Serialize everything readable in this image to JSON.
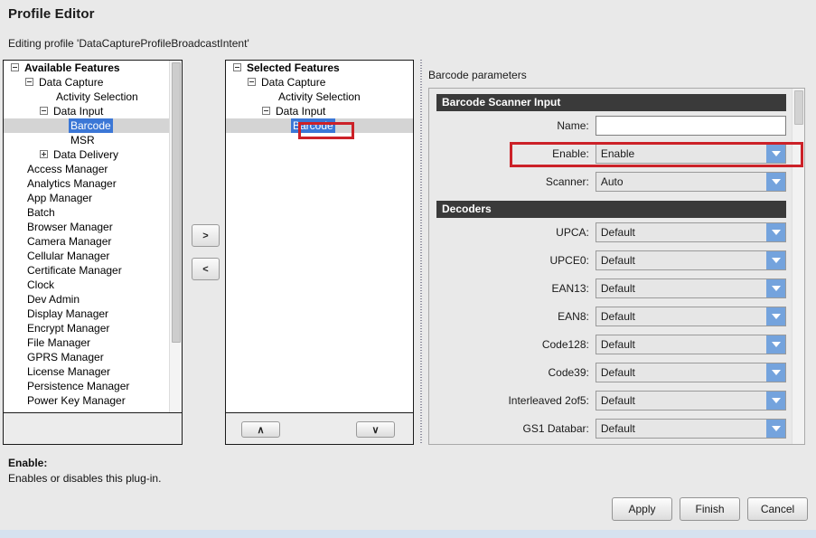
{
  "header": {
    "title": "Profile Editor",
    "subtitle": "Editing profile 'DataCaptureProfileBroadcastIntent'"
  },
  "available_features": {
    "root_label": "Available Features",
    "items": [
      {
        "label": "Available Features",
        "indent": 0,
        "expander": "minus",
        "bold": true,
        "selected": false
      },
      {
        "label": "Data Capture",
        "indent": 1,
        "expander": "minus",
        "bold": false,
        "selected": false
      },
      {
        "label": "Activity Selection",
        "indent": 3,
        "expander": "none",
        "bold": false,
        "selected": false
      },
      {
        "label": "Data Input",
        "indent": 2,
        "expander": "minus",
        "bold": false,
        "selected": false
      },
      {
        "label": "Barcode",
        "indent": 4,
        "expander": "none",
        "bold": false,
        "selected": true
      },
      {
        "label": "MSR",
        "indent": 4,
        "expander": "none",
        "bold": false,
        "selected": false
      },
      {
        "label": "Data Delivery",
        "indent": 2,
        "expander": "plus",
        "bold": false,
        "selected": false
      },
      {
        "label": "Access Manager",
        "indent": 1,
        "expander": "none",
        "bold": false,
        "selected": false
      },
      {
        "label": "Analytics Manager",
        "indent": 1,
        "expander": "none",
        "bold": false,
        "selected": false
      },
      {
        "label": "App Manager",
        "indent": 1,
        "expander": "none",
        "bold": false,
        "selected": false
      },
      {
        "label": "Batch",
        "indent": 1,
        "expander": "none",
        "bold": false,
        "selected": false
      },
      {
        "label": "Browser Manager",
        "indent": 1,
        "expander": "none",
        "bold": false,
        "selected": false
      },
      {
        "label": "Camera Manager",
        "indent": 1,
        "expander": "none",
        "bold": false,
        "selected": false
      },
      {
        "label": "Cellular Manager",
        "indent": 1,
        "expander": "none",
        "bold": false,
        "selected": false
      },
      {
        "label": "Certificate Manager",
        "indent": 1,
        "expander": "none",
        "bold": false,
        "selected": false
      },
      {
        "label": "Clock",
        "indent": 1,
        "expander": "none",
        "bold": false,
        "selected": false
      },
      {
        "label": "Dev Admin",
        "indent": 1,
        "expander": "none",
        "bold": false,
        "selected": false
      },
      {
        "label": "Display Manager",
        "indent": 1,
        "expander": "none",
        "bold": false,
        "selected": false
      },
      {
        "label": "Encrypt Manager",
        "indent": 1,
        "expander": "none",
        "bold": false,
        "selected": false
      },
      {
        "label": "File Manager",
        "indent": 1,
        "expander": "none",
        "bold": false,
        "selected": false
      },
      {
        "label": "GPRS Manager",
        "indent": 1,
        "expander": "none",
        "bold": false,
        "selected": false
      },
      {
        "label": "License Manager",
        "indent": 1,
        "expander": "none",
        "bold": false,
        "selected": false
      },
      {
        "label": "Persistence Manager",
        "indent": 1,
        "expander": "none",
        "bold": false,
        "selected": false
      },
      {
        "label": "Power Key Manager",
        "indent": 1,
        "expander": "none",
        "bold": false,
        "selected": false
      }
    ]
  },
  "transfer": {
    "add_label": ">",
    "remove_label": "<"
  },
  "selected_features": {
    "items": [
      {
        "label": "Selected Features",
        "indent": 0,
        "expander": "minus",
        "bold": true,
        "selected": false
      },
      {
        "label": "Data Capture",
        "indent": 1,
        "expander": "minus",
        "bold": false,
        "selected": false
      },
      {
        "label": "Activity Selection",
        "indent": 3,
        "expander": "none",
        "bold": false,
        "selected": false
      },
      {
        "label": "Data Input",
        "indent": 2,
        "expander": "minus",
        "bold": false,
        "selected": false
      },
      {
        "label": "Barcode",
        "indent": 4,
        "expander": "none",
        "bold": false,
        "selected": true
      }
    ],
    "move_up_label": "∧",
    "move_down_label": "∨"
  },
  "parameters": {
    "panel_label": "Barcode parameters",
    "sections": [
      {
        "title": "Barcode Scanner Input",
        "fields": [
          {
            "label": "Name:",
            "type": "text",
            "value": "",
            "placeholder": ""
          },
          {
            "label": "Enable:",
            "type": "combo",
            "value": "Enable",
            "highlighted": true
          },
          {
            "label": "Scanner:",
            "type": "combo",
            "value": "Auto",
            "highlighted": false
          }
        ]
      },
      {
        "title": "Decoders",
        "fields": [
          {
            "label": "UPCA:",
            "type": "combo",
            "value": "Default",
            "highlighted": false
          },
          {
            "label": "UPCE0:",
            "type": "combo",
            "value": "Default",
            "highlighted": false
          },
          {
            "label": "EAN13:",
            "type": "combo",
            "value": "Default",
            "highlighted": false
          },
          {
            "label": "EAN8:",
            "type": "combo",
            "value": "Default",
            "highlighted": false
          },
          {
            "label": "Code128:",
            "type": "combo",
            "value": "Default",
            "highlighted": false
          },
          {
            "label": "Code39:",
            "type": "combo",
            "value": "Default",
            "highlighted": false
          },
          {
            "label": "Interleaved 2of5:",
            "type": "combo",
            "value": "Default",
            "highlighted": false
          },
          {
            "label": "GS1 Databar:",
            "type": "combo",
            "value": "Default",
            "highlighted": false
          },
          {
            "label": "",
            "type": "combo-clipped",
            "value": "",
            "highlighted": false
          }
        ]
      }
    ]
  },
  "description": {
    "title": "Enable:",
    "text": "Enables or disables this plug-in."
  },
  "footer": {
    "apply_label": "Apply",
    "finish_label": "Finish",
    "cancel_label": "Cancel"
  },
  "colors": {
    "highlight_red": "#cc2128",
    "selection_blue": "#3b77d6",
    "section_header_bg": "#3a3a3a",
    "combo_arrow_blue": "#74a3dd"
  }
}
